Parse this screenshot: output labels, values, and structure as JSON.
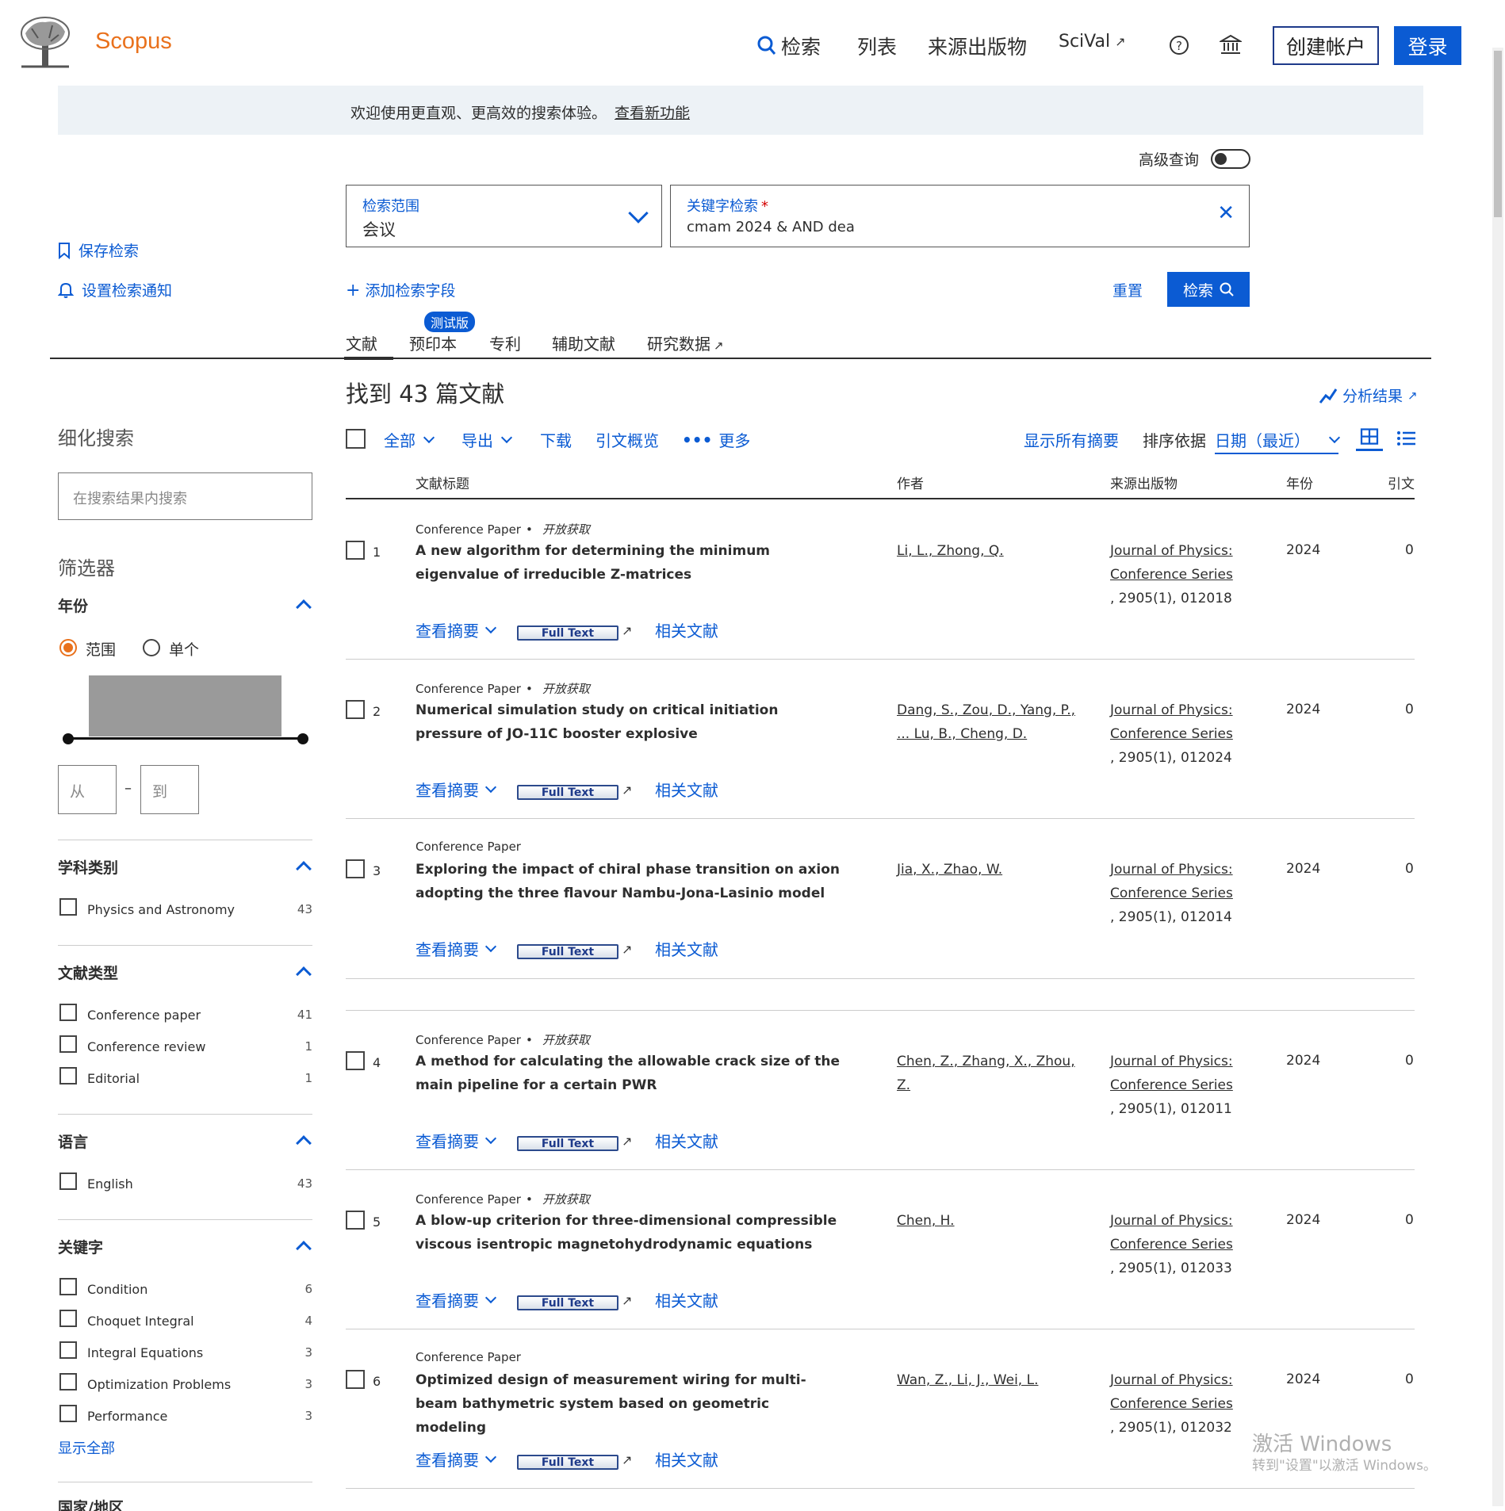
{
  "header": {
    "brand": "Scopus",
    "nav": {
      "search": "检索",
      "lists": "列表",
      "sources": "来源出版物",
      "scival": "SciVal",
      "ext_arrow": "↗"
    },
    "create_account": "创建帐户",
    "login": "登录"
  },
  "banner": {
    "text": "欢迎使用更直观、更高效的搜索体验。",
    "link": "查看新功能"
  },
  "search": {
    "advanced_label": "高级查询",
    "scope_label": "检索范围",
    "scope_value": "会议",
    "keyword_label": "关键字检索",
    "required_mark": "*",
    "keyword_value": "cmam 2024 & AND dea",
    "add_field": "添加检索字段",
    "reset": "重置",
    "search_button": "检索",
    "save_search": "保存检索",
    "set_alert": "设置检索通知"
  },
  "tabs": [
    {
      "label": "文献"
    },
    {
      "label": "预印本"
    },
    {
      "label": "专利"
    },
    {
      "label": "辅助文献"
    },
    {
      "label": "研究数据"
    }
  ],
  "beta_badge": "测试版",
  "refine": {
    "title": "细化搜索",
    "placeholder": "在搜索结果内搜索",
    "filters_title": "筛选器",
    "year": {
      "title": "年份",
      "range": "范围",
      "single": "单个",
      "from": "从",
      "to": "到",
      "dash": "–"
    },
    "subject": {
      "title": "学科类别",
      "items": [
        {
          "label": "Physics and Astronomy",
          "count": "43"
        }
      ]
    },
    "doctype": {
      "title": "文献类型",
      "items": [
        {
          "label": "Conference paper",
          "count": "41"
        },
        {
          "label": "Conference review",
          "count": "1"
        },
        {
          "label": "Editorial",
          "count": "1"
        }
      ]
    },
    "language": {
      "title": "语言",
      "items": [
        {
          "label": "English",
          "count": "43"
        }
      ]
    },
    "keywords": {
      "title": "关键字",
      "items": [
        {
          "label": "Condition",
          "count": "6"
        },
        {
          "label": "Choquet Integral",
          "count": "4"
        },
        {
          "label": "Integral Equations",
          "count": "3"
        },
        {
          "label": "Optimization Problems",
          "count": "3"
        },
        {
          "label": "Performance",
          "count": "3"
        }
      ],
      "show_all": "显示全部"
    },
    "country": {
      "title": "国家/地区"
    }
  },
  "results": {
    "title": "找到 43 篇文献",
    "analyze": "分析结果",
    "toolbar": {
      "all": "全部",
      "export": "导出",
      "download": "下载",
      "citation_overview": "引文概览",
      "more": "更多",
      "show_abstracts": "显示所有摘要",
      "sort_label": "排序依据",
      "sort_value": "日期（最近）"
    },
    "columns": {
      "title": "文献标题",
      "authors": "作者",
      "source": "来源出版物",
      "year": "年份",
      "cited": "引文"
    },
    "actions": {
      "view_abstract": "查看摘要",
      "full_text": "Full Text",
      "ext_arrow": "↗",
      "related": "相关文献"
    },
    "rows": [
      {
        "index": "1",
        "type": "Conference Paper",
        "oa": "开放获取",
        "title": "A new algorithm for determining the minimum eigenvalue of irreducible Z-matrices",
        "authors": "Li, L., Zhong, Q.",
        "source_name": "Journal of Physics: Conference Series",
        "source_detail": ", 2905(1), 012018",
        "year": "2024",
        "cited": "0"
      },
      {
        "index": "2",
        "type": "Conference Paper",
        "oa": "开放获取",
        "title": "Numerical simulation study on critical initiation pressure of JO-11C booster explosive",
        "authors": "Dang, S., Zou, D., Yang, P., ... Lu, B., Cheng, D.",
        "source_name": "Journal of Physics: Conference Series",
        "source_detail": ", 2905(1), 012024",
        "year": "2024",
        "cited": "0"
      },
      {
        "index": "3",
        "type": "Conference Paper",
        "oa": "",
        "title": "Exploring the impact of chiral phase transition on axion adopting the three flavour Nambu-Jona-Lasinio model",
        "authors": "Jia, X., Zhao, W.",
        "source_name": "Journal of Physics: Conference Series",
        "source_detail": ", 2905(1), 012014",
        "year": "2024",
        "cited": "0"
      },
      {
        "index": "4",
        "type": "Conference Paper",
        "oa": "开放获取",
        "title": "A method for calculating the allowable crack size of the main pipeline for a certain PWR",
        "authors": "Chen, Z., Zhang, X., Zhou, Z.",
        "source_name": "Journal of Physics: Conference Series",
        "source_detail": ", 2905(1), 012011",
        "year": "2024",
        "cited": "0"
      },
      {
        "index": "5",
        "type": "Conference Paper",
        "oa": "开放获取",
        "title": "A blow-up criterion for three-dimensional compressible viscous isentropic magnetohydrodynamic equations",
        "authors": "Chen, H.",
        "source_name": "Journal of Physics: Conference Series",
        "source_detail": ", 2905(1), 012033",
        "year": "2024",
        "cited": "0"
      },
      {
        "index": "6",
        "type": "Conference Paper",
        "oa": "",
        "title": "Optimized design of measurement wiring for multi-beam bathymetric system based on geometric modeling",
        "authors": "Wan, Z., Li, J., Wei, L.",
        "source_name": "Journal of Physics: Conference Series",
        "source_detail": ", 2905(1), 012032",
        "year": "2024",
        "cited": "0"
      }
    ]
  },
  "watermark": {
    "line1": "激活 Windows",
    "line2": "转到\"设置\"以激活 Windows。"
  },
  "colors": {
    "accent": "#0b5bd3",
    "brand": "#e9711c"
  }
}
